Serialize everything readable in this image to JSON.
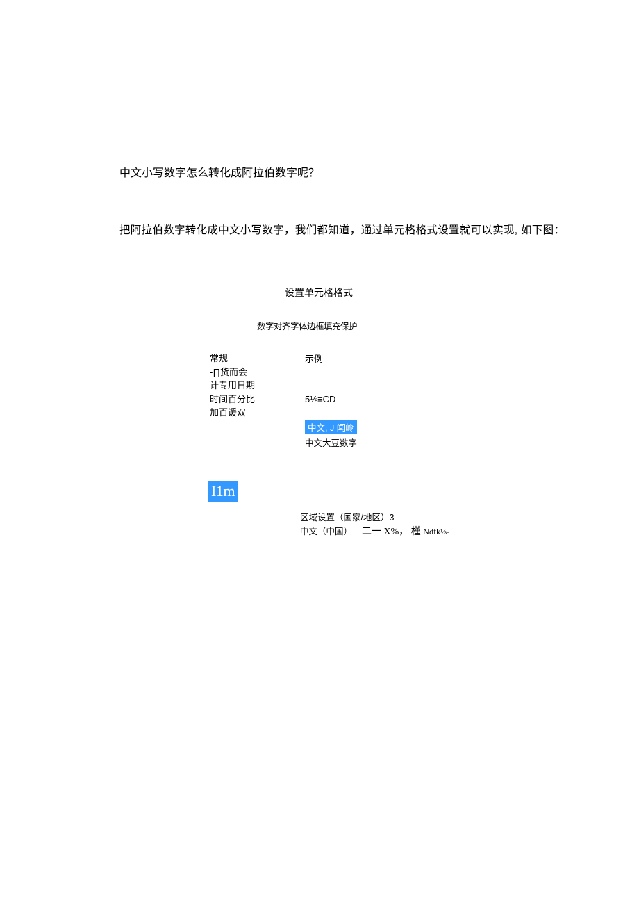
{
  "heading": "中文小写数字怎么转化成阿拉伯数字呢？",
  "description": "把阿拉伯数字转化成中文小写数字，我们都知道，通过单元格格式设置就可以实现, 如下图：",
  "dialog": {
    "title": "设置单元格格式",
    "tabs": "数字对齐字体边框填充保护",
    "categories": {
      "line1": "常规",
      "line2": "-∏货而会",
      "line3": "计专用日期",
      "line4": "时间百分比",
      "line5": "加百谖双"
    },
    "right": {
      "example_label": "示例",
      "type_value": "5⅛≡CD",
      "selected": "中文,  J 闻岭",
      "unselected": "中文大豆数字"
    },
    "badge": "I1m",
    "region": {
      "label": "区域设置（国家/地区）3",
      "locale": "中文（中国）",
      "trailing": "二一 X%，  槿",
      "trailing_small": "Ndfk⅛-"
    }
  }
}
